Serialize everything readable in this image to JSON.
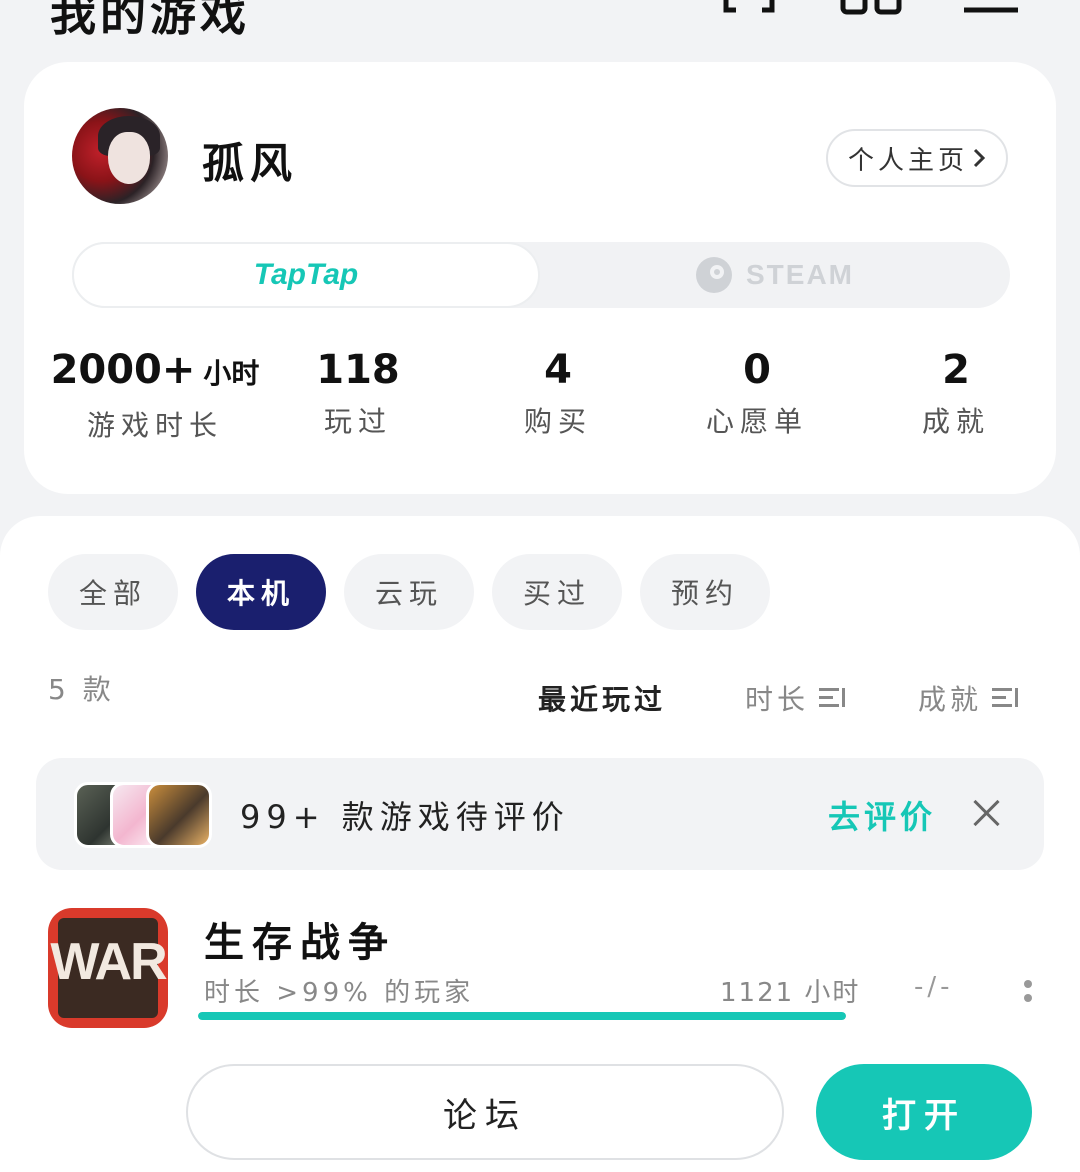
{
  "header": {
    "title": "我的游戏",
    "icons": [
      "scan-icon",
      "grid-icon",
      "menu-icon"
    ]
  },
  "profile": {
    "username": "孤风",
    "home_button": "个人主页",
    "platforms": {
      "active": "TapTap",
      "inactive": "STEAM"
    },
    "stats": [
      {
        "value": "2000+",
        "unit": "小时",
        "label": "游戏时长"
      },
      {
        "value": "118",
        "label": "玩过"
      },
      {
        "value": "4",
        "label": "购买"
      },
      {
        "value": "0",
        "label": "心愿单"
      },
      {
        "value": "2",
        "label": "成就"
      }
    ]
  },
  "filters": {
    "chips": [
      "全部",
      "本机",
      "云玩",
      "买过",
      "预约"
    ],
    "selected": "本机"
  },
  "list": {
    "count_label": "5 款",
    "sort": {
      "recent": "最近玩过",
      "time": "时长",
      "achievement": "成就"
    }
  },
  "review_banner": {
    "text": "99+ 款游戏待评价",
    "action": "去评价"
  },
  "game": {
    "icon_text": "WAR",
    "title": "生存战争",
    "subtitle": "时长 >99% 的玩家",
    "hours": "1121 小时",
    "score": "-/-",
    "progress": 1.0
  },
  "actions": {
    "forum": "论坛",
    "open": "打开"
  },
  "colors": {
    "accent": "#16c7b6",
    "selected_chip": "#1a1f6e",
    "background": "#f2f3f5"
  }
}
